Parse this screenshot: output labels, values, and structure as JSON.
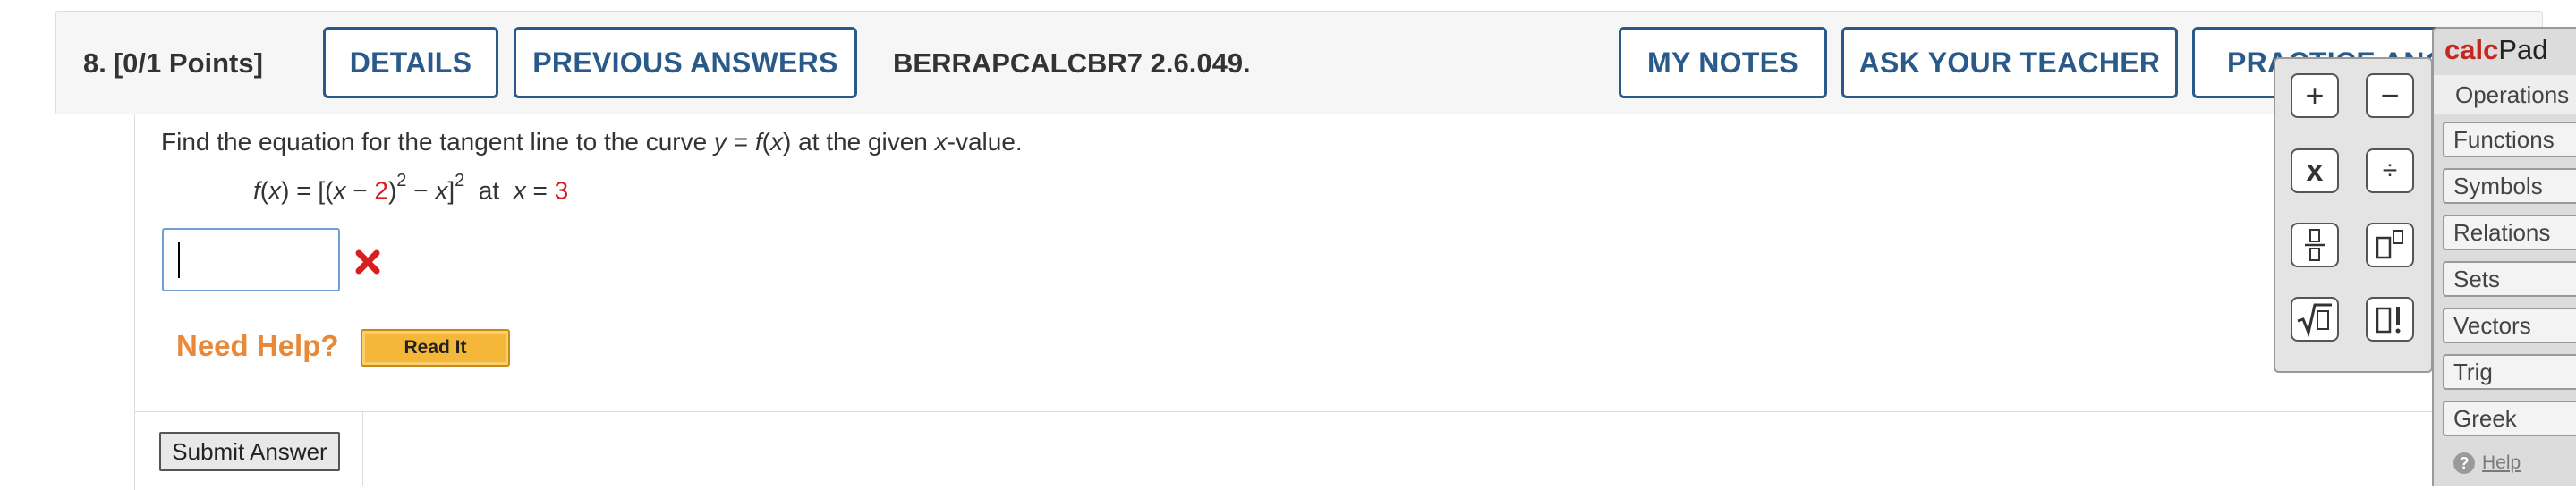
{
  "header": {
    "number": "8.",
    "points": "[0/1 Points]",
    "details_label": "DETAILS",
    "previous_answers_label": "PREVIOUS ANSWERS",
    "question_code": "BERRAPCALCBR7 2.6.049.",
    "my_notes_label": "MY NOTES",
    "ask_teacher_label": "ASK YOUR TEACHER",
    "practice_label": "PRACTICE ANOTHER"
  },
  "question": {
    "prompt_parts": [
      "Find the equation for the tangent line to the curve ",
      "y",
      " = ",
      "f",
      "(",
      "x",
      ") at the given ",
      "x",
      "-value."
    ],
    "formula": {
      "fx": "f",
      "x1": "x",
      "eq_open": ") = [(",
      "x2": "x",
      "minus1": " − ",
      "c1": "2",
      "close1": ")",
      "exp1": "2",
      "minus2": " − ",
      "x3": "x",
      "close2": "]",
      "exp2": "2",
      "at": "  at  ",
      "x4": "x",
      "eq2": " = ",
      "c2": "3"
    },
    "answer_value": "",
    "answer_status": "incorrect"
  },
  "help": {
    "need_help": "Need Help?",
    "read_it": "Read It"
  },
  "submit_label": "Submit Answer",
  "calcpad": {
    "logo_calc": "calc",
    "logo_pad": "Pad",
    "operations_label": "Operations",
    "tabs": [
      "Functions",
      "Symbols",
      "Relations",
      "Sets",
      "Vectors",
      "Trig",
      "Greek"
    ],
    "help_label": "Help",
    "buttons": [
      "+",
      "−",
      "x",
      "÷",
      "▯/▯",
      "▯▯",
      "√▯",
      "▯!"
    ]
  },
  "colors": {
    "accent_blue": "#2a5a8a",
    "incorrect_red": "#d81e1e",
    "need_help_orange": "#e8893a",
    "read_it_yellow": "#f4b73a",
    "calc_red": "#c8251e"
  }
}
